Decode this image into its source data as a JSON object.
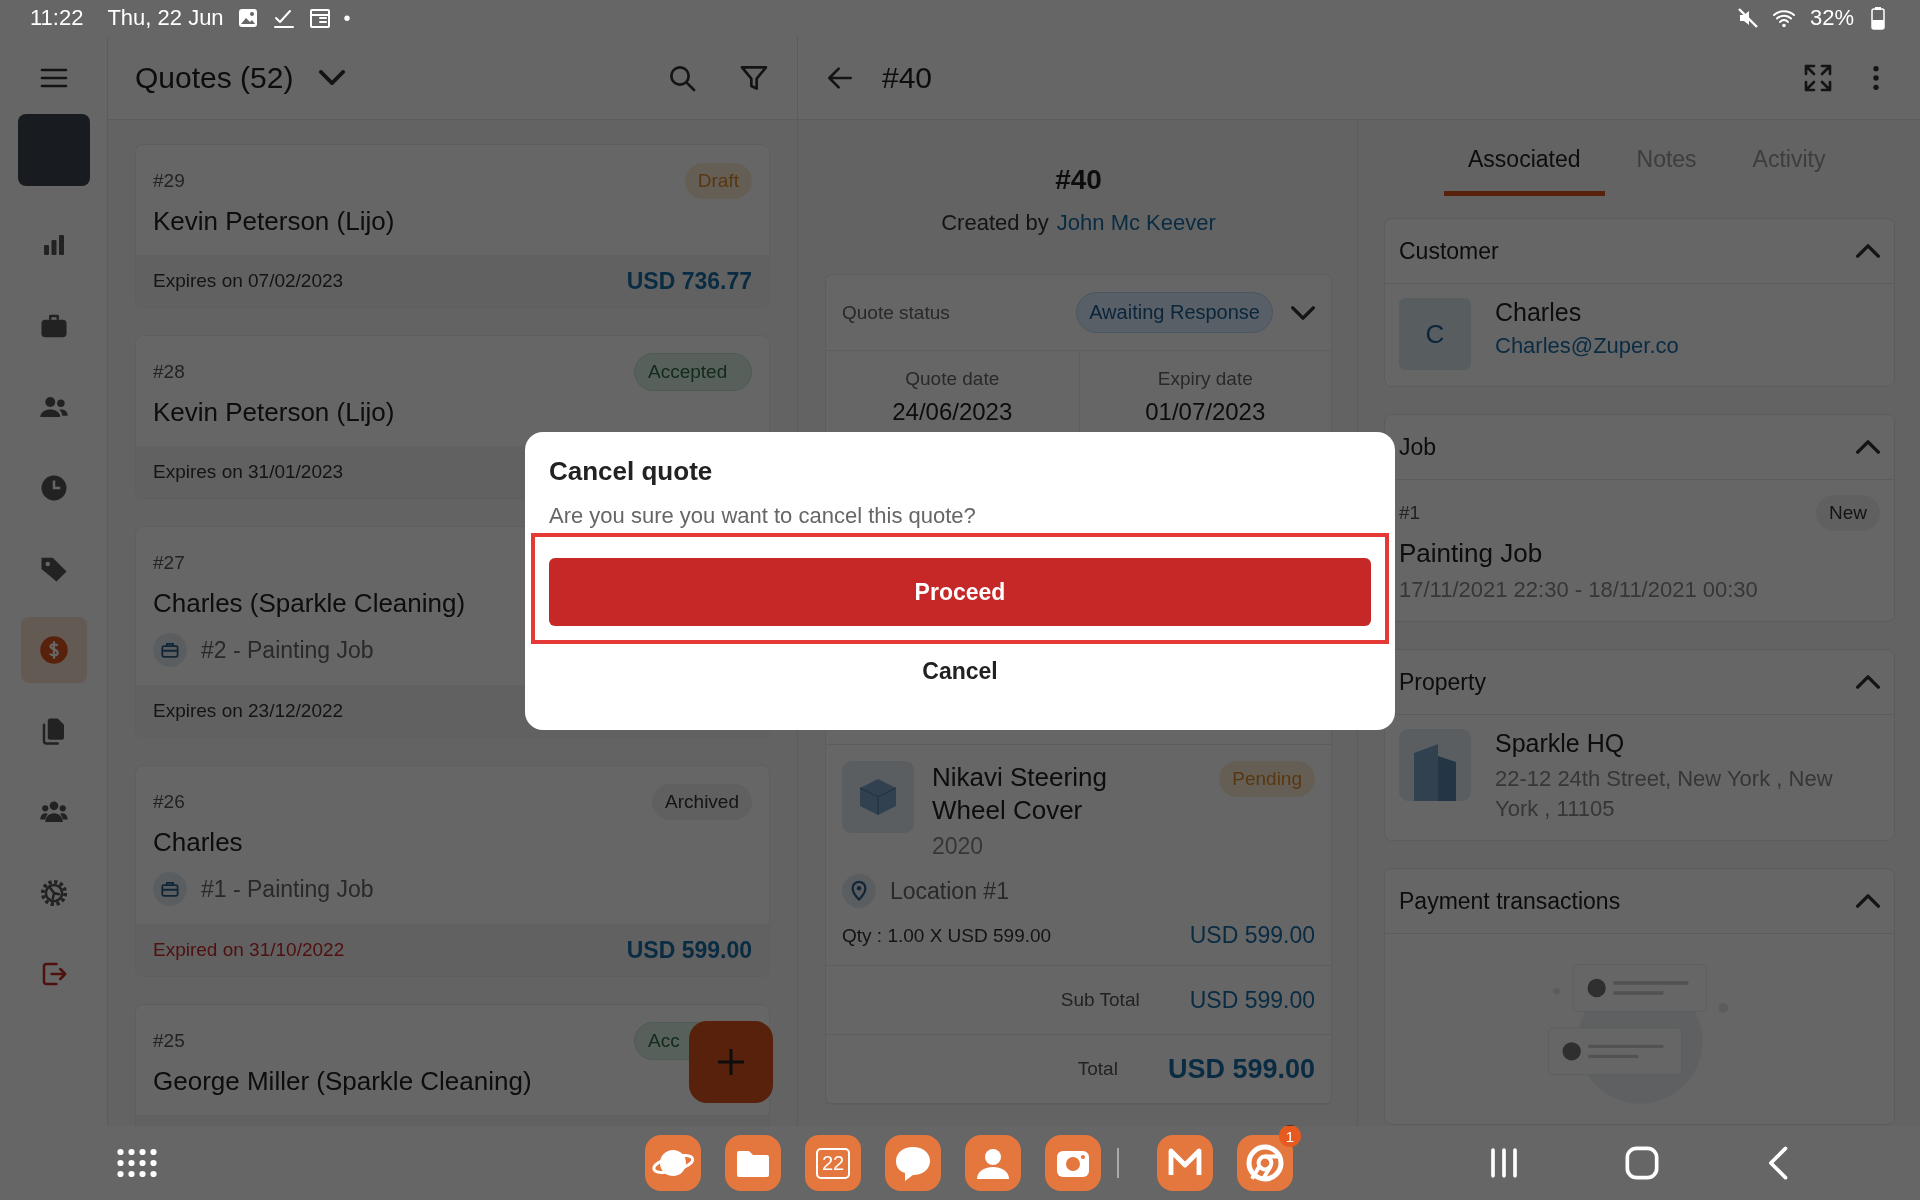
{
  "status_bar": {
    "time": "11:22",
    "date": "Thu, 22 Jun",
    "dot": "•",
    "battery": "32%"
  },
  "sidebar": {
    "items": [
      {
        "kind": "nav",
        "selected": false
      },
      {
        "kind": "nav",
        "selected": false
      },
      {
        "kind": "nav",
        "selected": false
      },
      {
        "kind": "nav",
        "selected": false
      },
      {
        "kind": "nav",
        "selected": false
      },
      {
        "kind": "nav",
        "selected": true
      },
      {
        "kind": "nav",
        "selected": false
      },
      {
        "kind": "nav",
        "selected": false
      },
      {
        "kind": "nav",
        "selected": false
      },
      {
        "kind": "logout",
        "selected": false
      }
    ]
  },
  "list": {
    "title": "Quotes (52)",
    "cards": [
      {
        "number": "#29",
        "status": "Draft",
        "kind": "draft",
        "name": "Kevin Peterson (Lijo)",
        "expiry": "Expires on 07/02/2023",
        "expired": false,
        "amount": "USD 736.77"
      },
      {
        "number": "#28",
        "status": "Accepted",
        "kind": "accepted",
        "name": "Kevin Peterson (Lijo)",
        "expiry": "Expires on 31/01/2023",
        "expired": false
      },
      {
        "number": "#27",
        "name": "Charles (Sparkle Cleaning)",
        "job": "#2 - Painting Job",
        "expiry": "Expires on 23/12/2022",
        "expired": false
      },
      {
        "number": "#26",
        "status": "Archived",
        "kind": "archived",
        "name": "Charles",
        "job": "#1 - Painting Job",
        "expiry": "Expired on 31/10/2022",
        "expired": true,
        "amount": "USD 599.00"
      },
      {
        "number": "#25",
        "status": "Acc",
        "kind": "accepted",
        "name": "George Miller (Sparkle Cleaning)"
      }
    ]
  },
  "detail": {
    "title": "#40",
    "heading": "#40",
    "created_by_label": "Created by",
    "created_by": "John Mc Keever",
    "quote_status_label": "Quote status",
    "quote_status": "Awaiting Response",
    "dates": [
      {
        "label": "Quote date",
        "value": "24/06/2023"
      },
      {
        "label": "Expiry date",
        "value": "01/07/2023"
      }
    ],
    "line_item": {
      "name": "Nikavi Steering Wheel Cover",
      "year": "2020",
      "status": "Pending",
      "location": "Location #1",
      "qty": "Qty : 1.00 X USD 599.00",
      "amount": "USD 599.00"
    },
    "totals": [
      {
        "kind": "sub",
        "label": "Sub Total",
        "value": "USD 599.00"
      },
      {
        "kind": "grand",
        "label": "Total",
        "value": "USD 599.00"
      }
    ]
  },
  "tabs": [
    {
      "label": "Associated",
      "selected": true
    },
    {
      "label": "Notes",
      "selected": false
    },
    {
      "label": "Activity",
      "selected": false
    }
  ],
  "sections": [
    {
      "kind": "customer",
      "title": "Customer",
      "expanded": true,
      "initial": "C",
      "name": "Charles",
      "email": "Charles@Zuper.co"
    },
    {
      "kind": "job",
      "title": "Job",
      "expanded": true,
      "number": "#1",
      "status": "New",
      "name": "Painting Job",
      "time": "17/11/2021 22:30 - 18/11/2021 00:30"
    },
    {
      "kind": "property",
      "title": "Property",
      "expanded": true,
      "name": "Sparkle HQ",
      "address": "22-12 24th Street, New York , New York , 11105"
    },
    {
      "kind": "payments",
      "title": "Payment transactions",
      "expanded": true
    }
  ],
  "dialog": {
    "title": "Cancel quote",
    "message": "Are you sure you want to cancel this quote?",
    "buttons": [
      {
        "kind": "primary",
        "label": "Proceed",
        "highlighted": true
      },
      {
        "kind": "text",
        "label": "Cancel",
        "highlighted": false
      }
    ]
  },
  "dock": {
    "calendar_day": "22",
    "badge": "1"
  }
}
